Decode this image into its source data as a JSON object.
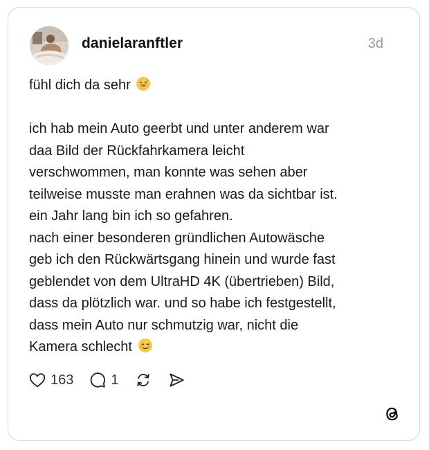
{
  "post": {
    "username": "danielaranftler",
    "timestamp": "3d",
    "intro": "fühl dich da sehr",
    "intro_emoji": "sweat-smile-emoji",
    "body": "ich hab mein Auto geerbt und unter anderem war\ndaa Bild der Rückfahrkamera leicht\nverschwommen, man konnte was sehen aber\nteilweise musste man erahnen was da sichtbar ist.\nein Jahr lang bin ich so gefahren.\nnach einer besonderen gründlichen Autowäsche\ngeb ich den Rückwärtsgang hinein und wurde fast\ngeblendet von dem UltraHD 4K (übertrieben) Bild,\ndass da plötzlich war. und so habe ich festgestellt,\ndass mein Auto nur schmutzig war, nicht die\nKamera schlecht",
    "body_emoji": "smiling-with-tear-emoji"
  },
  "actions": {
    "likes": "163",
    "replies": "1",
    "like_icon": "heart-icon",
    "reply_icon": "comment-icon",
    "repost_icon": "repost-icon",
    "share_icon": "send-icon"
  },
  "branding": {
    "logo_icon": "threads-logo-icon"
  },
  "colors": {
    "border": "#d7d7d7",
    "muted": "#9a9a9a",
    "text": "#1a1a1a"
  }
}
